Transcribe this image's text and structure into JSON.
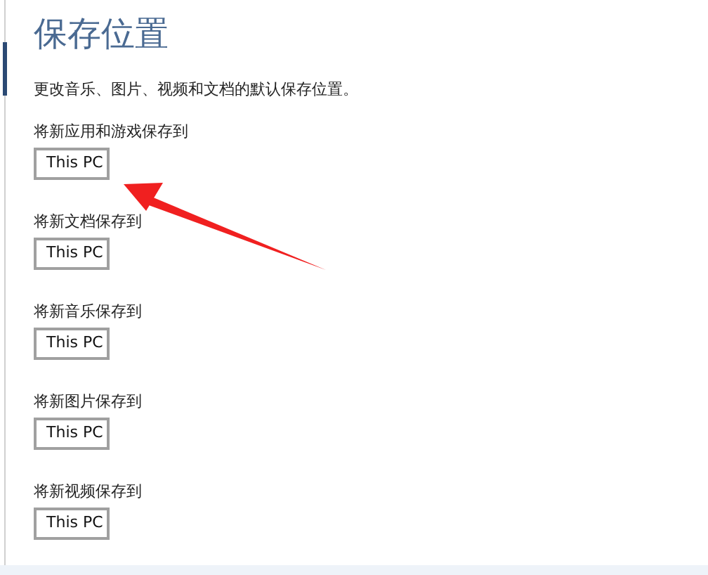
{
  "title": "保存位置",
  "description": "更改音乐、图片、视频和文档的默认保存位置。",
  "settings": [
    {
      "label": "将新应用和游戏保存到",
      "value": "This PC"
    },
    {
      "label": "将新文档保存到",
      "value": "This PC"
    },
    {
      "label": "将新音乐保存到",
      "value": "This PC"
    },
    {
      "label": "将新图片保存到",
      "value": "This PC"
    },
    {
      "label": "将新视频保存到",
      "value": "This PC"
    }
  ]
}
